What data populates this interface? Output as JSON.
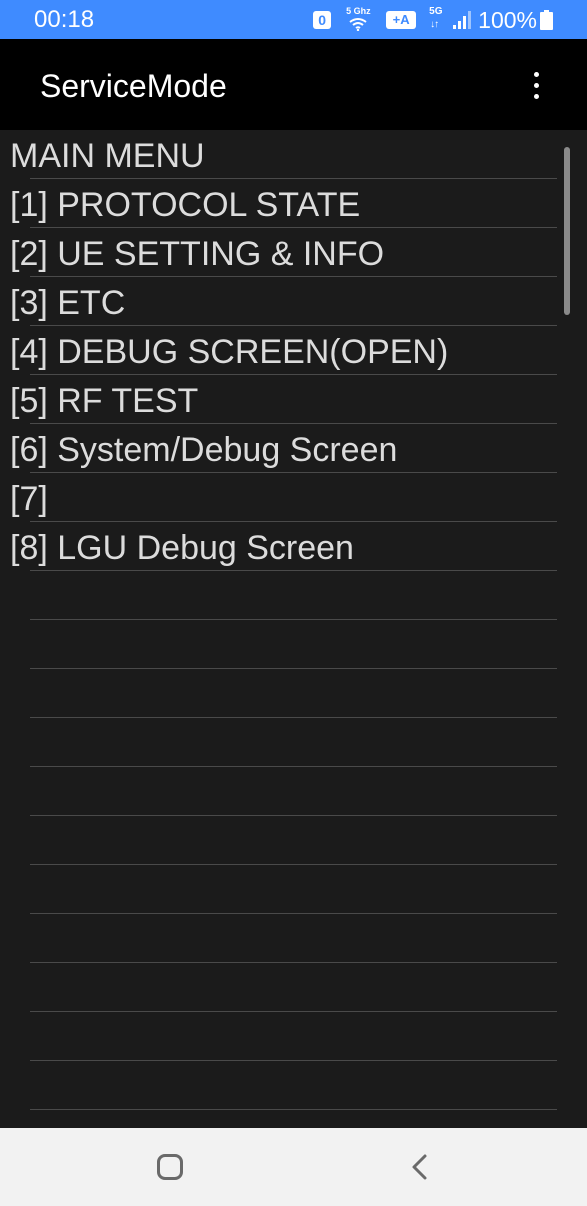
{
  "status_bar": {
    "time": "00:18",
    "notification_badge": "0",
    "wifi_band": "5 Ghz",
    "wifi_icon": "wifi-icon",
    "call_badge": "+A",
    "network_type": "5G",
    "network_arrows": "↓↑",
    "signal_icon": "signal-icon",
    "battery_percent": "100%",
    "battery_icon": "battery-icon",
    "background_color": "#3f8bff"
  },
  "app_bar": {
    "title": "ServiceMode",
    "menu_icon": "more-vert-icon"
  },
  "menu": {
    "items": [
      {
        "label": "MAIN MENU"
      },
      {
        "label": "[1] PROTOCOL STATE"
      },
      {
        "label": "[2] UE SETTING & INFO"
      },
      {
        "label": "[3] ETC"
      },
      {
        "label": "[4] DEBUG SCREEN(OPEN)"
      },
      {
        "label": "[5] RF TEST"
      },
      {
        "label": "[6] System/Debug Screen"
      },
      {
        "label": "[7]"
      },
      {
        "label": "[8] LGU Debug Screen"
      },
      {
        "label": ""
      },
      {
        "label": ""
      },
      {
        "label": ""
      },
      {
        "label": ""
      },
      {
        "label": ""
      },
      {
        "label": ""
      },
      {
        "label": ""
      },
      {
        "label": ""
      },
      {
        "label": ""
      },
      {
        "label": ""
      },
      {
        "label": ""
      },
      {
        "label": ""
      }
    ]
  },
  "nav_bar": {
    "home_icon": "home-square-icon",
    "back_icon": "back-chevron-icon"
  }
}
